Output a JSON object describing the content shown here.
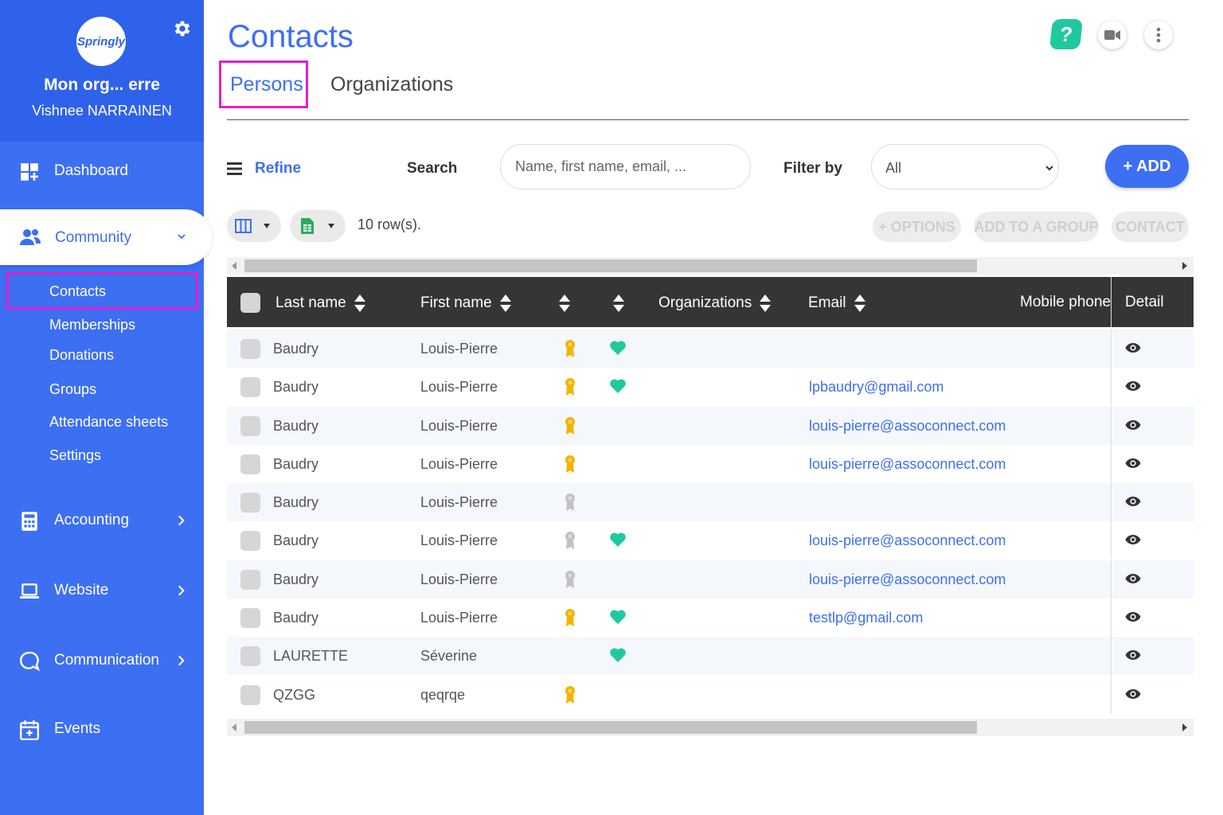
{
  "sidebar": {
    "logo_text": "Springly",
    "org_name": "Mon org... erre",
    "user_name": "Vishnee NARRAINEN",
    "dashboard_label": "Dashboard",
    "community_label": "Community",
    "community_items": [
      "Contacts",
      "Memberships",
      "Donations",
      "Groups",
      "Attendance sheets",
      "Settings"
    ],
    "accounting_label": "Accounting",
    "website_label": "Website",
    "communication_label": "Communication",
    "events_label": "Events"
  },
  "header": {
    "title": "Contacts",
    "help_label": "?",
    "tabs": [
      "Persons",
      "Organizations"
    ],
    "active_tab": "Persons"
  },
  "toolbar": {
    "refine_label": "Refine",
    "search_label": "Search",
    "search_placeholder": "Name, first name, email, ...",
    "filter_label": "Filter by",
    "filter_value": "All",
    "add_label": "+ ADD",
    "row_count": "10 row(s).",
    "options_label": "+ OPTIONS",
    "add_group_label": "ADD TO A GROUP",
    "contact_label": "CONTACT"
  },
  "table": {
    "columns": [
      "Last name",
      "First name",
      "",
      "",
      "Organizations",
      "Email",
      "Mobile phone",
      "Detail"
    ],
    "rows": [
      {
        "last": "Baudry",
        "first": "Louis-Pierre",
        "medal": "gold",
        "heart": true,
        "email": ""
      },
      {
        "last": "Baudry",
        "first": "Louis-Pierre",
        "medal": "gold",
        "heart": true,
        "email": "lpbaudry@gmail.com"
      },
      {
        "last": "Baudry",
        "first": "Louis-Pierre",
        "medal": "gold",
        "heart": false,
        "email": "louis-pierre@assoconnect.com"
      },
      {
        "last": "Baudry",
        "first": "Louis-Pierre",
        "medal": "gold",
        "heart": false,
        "email": "louis-pierre@assoconnect.com"
      },
      {
        "last": "Baudry",
        "first": "Louis-Pierre",
        "medal": "grey",
        "heart": false,
        "email": ""
      },
      {
        "last": "Baudry",
        "first": "Louis-Pierre",
        "medal": "grey",
        "heart": true,
        "email": "louis-pierre@assoconnect.com"
      },
      {
        "last": "Baudry",
        "first": "Louis-Pierre",
        "medal": "grey",
        "heart": false,
        "email": "louis-pierre@assoconnect.com"
      },
      {
        "last": "Baudry",
        "first": "Louis-Pierre",
        "medal": "gold",
        "heart": true,
        "email": "testlp@gmail.com"
      },
      {
        "last": "LAURETTE",
        "first": "Séverine",
        "medal": "none",
        "heart": true,
        "email": ""
      },
      {
        "last": "QZGG",
        "first": "qeqrqe",
        "medal": "gold",
        "heart": false,
        "email": ""
      }
    ]
  },
  "colors": {
    "primary": "#3d6ff2",
    "sidebar": "#3d6ff2",
    "teal": "#1fc9a0",
    "medal_gold": "#f5b300",
    "medal_grey": "#c2c2c2",
    "highlight": "#e020d0"
  }
}
